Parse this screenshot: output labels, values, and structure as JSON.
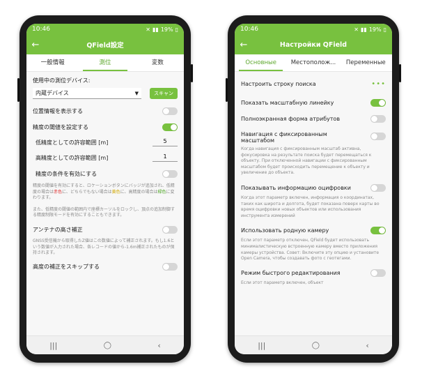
{
  "status_left": {
    "time": "10:46",
    "battery": "19%"
  },
  "status_right": {
    "time": "10:46",
    "battery": "19%"
  },
  "left": {
    "appbar_title": "QField設定",
    "tabs": [
      "一般情報",
      "測位",
      "変数"
    ],
    "active_tab": 1,
    "device_label": "使用中の測位デバイス:",
    "device_value": "内蔵デバイス",
    "scan_label": "スキャン",
    "show_position": "位置情報を表示する",
    "accuracy_threshold": "精度の閾値を設定する",
    "low_accuracy": {
      "label": "低精度としての許容範囲 [m]",
      "value": "5"
    },
    "high_accuracy": {
      "label": "高精度としての許容範囲 [m]",
      "value": "1"
    },
    "enable_conditions": "精度の条件を有効にする",
    "desc1_a": "精度の閾値を有効にすると、ロケーションボタンにバッジが追加され、低精度の場合は",
    "desc1_red": "赤色",
    "desc1_b": "に、どちらでもない場合は",
    "desc1_yellow": "黄色",
    "desc1_c": "に、高精度の場合",
    "desc1_d": "は",
    "desc1_green": "緑色",
    "desc1_e": "に変わります。",
    "desc2": "また、低精度の閾値の範囲内で座標カーソルをロックし、頂点の追加制御する精度制限モードを有効にすることもできます。",
    "antenna": "アンテナの高さ補正",
    "antenna_desc": "GNSS受信機から取得したZ値はこの数値によって補正されます。もし1.6という数値が入力された場合、各レコードの値から-1.6m補正されたものが保持されます。",
    "skip_altitude": "高度の補正をスキップする"
  },
  "right": {
    "appbar_title": "Настройки QField",
    "tabs": [
      "Основные",
      "Местополож...",
      "Переменные"
    ],
    "active_tab": 0,
    "search_bar": "Настроить строку поиска",
    "scale_bar": "Показать масштабную линейку",
    "fullscreen_form": "Полноэкранная форма атрибутов",
    "fixed_nav_1": "Навигация с фиксированным",
    "fixed_nav_2": "масштабом",
    "fixed_nav_desc": "Когда навигация с фиксированным масштаб активна, фокусировка на результате поиска будет перемещаться к объекту. При отключенной навигации с фиксированным масштабом будет происходить перемещение к объекту и увеличение до объекта.",
    "digitize_info": "Показывать информацию оцифровки",
    "digitize_desc": "Когда этот параметр включен, информация о координатах, таких как широта и долгота, будет показана поверх карты во время оцифровки новых объектов или использования инструмента измерений",
    "native_camera": "Использовать родную камеру",
    "native_camera_desc": "Если этот параметр отключен, QField будет использовать минималистическую встроенную камеру вместо приложения камеры устройства. Совет: Включите эту опцию и установите Open Camera, чтобы создавать фото с геотегами.",
    "quick_edit": "Режим быстрого редактирования",
    "quick_edit_desc": "Если этот параметр включен, объект"
  },
  "nav_icons": [
    "recent-apps-icon",
    "home-icon",
    "back-icon"
  ],
  "colors": {
    "accent": "#78c13f",
    "toggle_off": "#d6d6d6"
  }
}
